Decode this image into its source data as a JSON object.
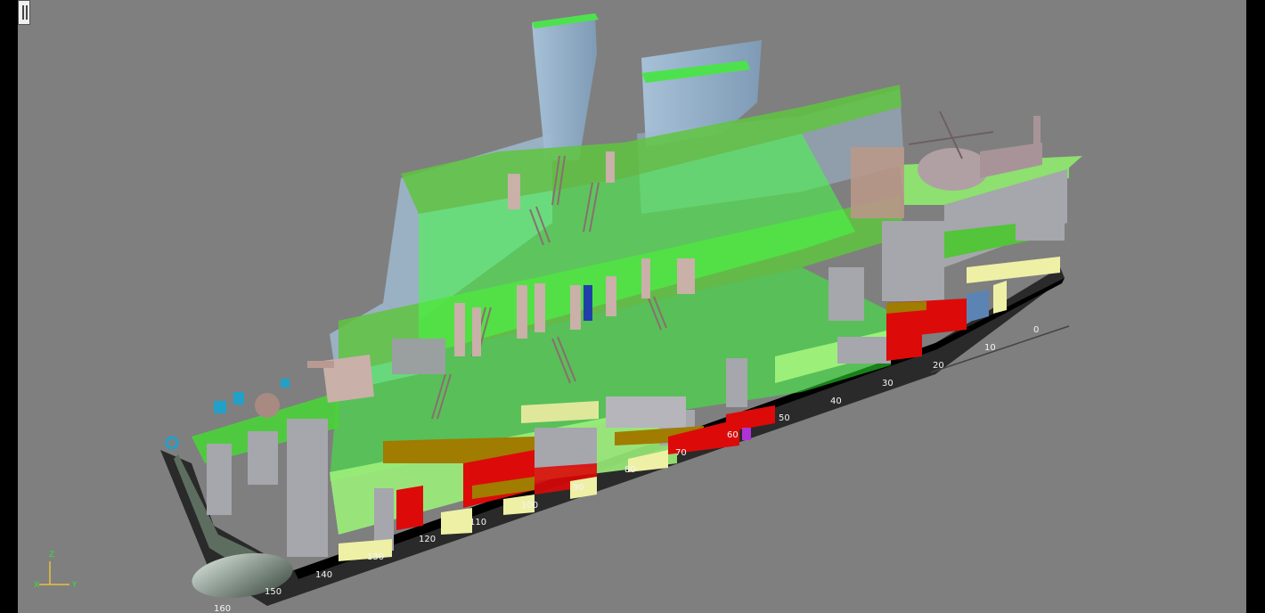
{
  "viewport": {
    "background": "#7f7f7f",
    "margin_color": "#000000"
  },
  "axes": {
    "z": "Z",
    "x": "X",
    "y": "Y"
  },
  "frame_labels": [
    "0",
    "10",
    "20",
    "30",
    "40",
    "50",
    "60",
    "70",
    "80",
    "90",
    "100",
    "110",
    "120",
    "130",
    "140",
    "150",
    "160"
  ],
  "colors": {
    "deck_green": "#5fc43f",
    "light_green": "#9cf07a",
    "bright_green": "#33ff33",
    "glass_blue": "#9fb8cf",
    "bulkhead_gray": "#a6a6ad",
    "tank_red": "#dd0a0a",
    "tank_olive": "#a07c00",
    "tank_yellow": "#eef0a6",
    "weapon_blue": "#21a0c8",
    "keel_black": "#000000",
    "hull_gray": "#6e8070"
  }
}
